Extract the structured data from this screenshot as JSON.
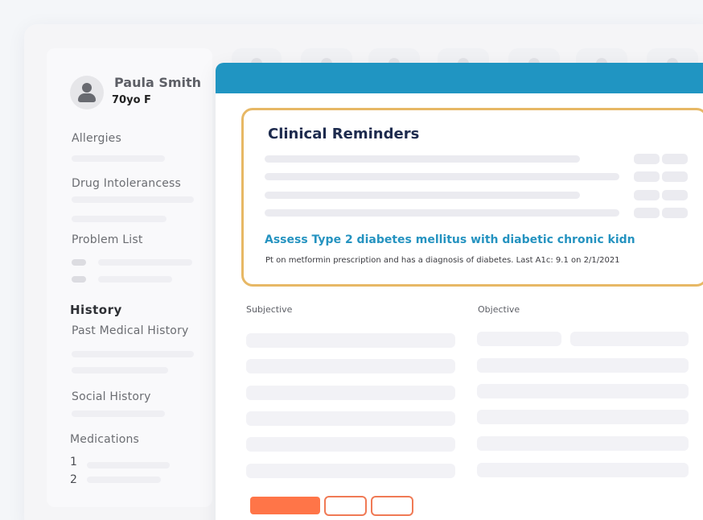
{
  "patient": {
    "name": "Paula Smith",
    "meta": "70yo F"
  },
  "sidebar": {
    "allergies": "Allergies",
    "drug_intolerances": "Drug Intolerancess",
    "problem_list": "Problem List",
    "history_heading": "History",
    "past_medical_history": "Past Medical History",
    "social_history": "Social History",
    "medications": "Medications",
    "medication_numbers": [
      "1",
      "2"
    ]
  },
  "clinical_reminders": {
    "title": "Clinical Reminders",
    "reminder_title": "Assess Type 2 diabetes mellitus with diabetic chronic kidn",
    "reminder_detail": "Pt on metformin prescription and has a diagnosis of diabetes. Last A1c: 9.1 on 2/1/2021"
  },
  "note": {
    "subjective_label": "Subjective",
    "objective_label": "Objective"
  },
  "colors": {
    "header": "#2095c2",
    "reminder_border": "#e7b865",
    "reminder_link": "#2593c0",
    "primary_button": "#ff7548"
  },
  "icons": {
    "avatar": "user-avatar-icon"
  }
}
